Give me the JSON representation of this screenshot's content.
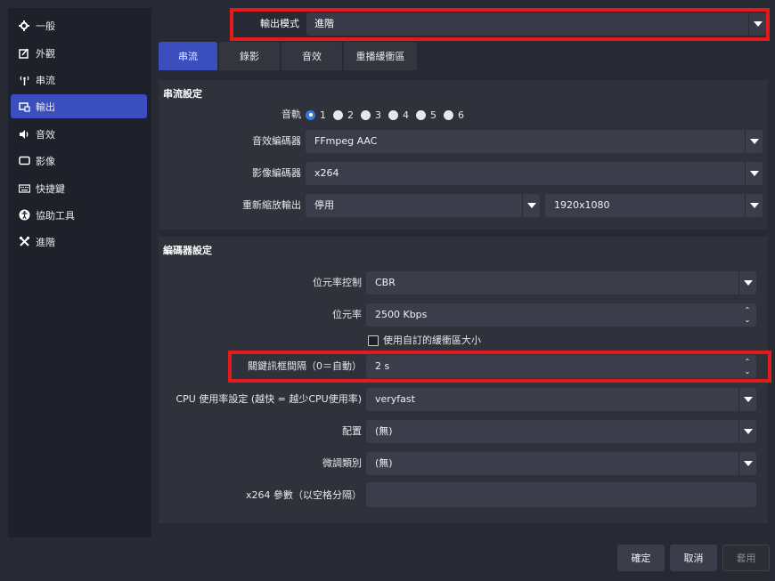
{
  "sidebar": {
    "items": [
      {
        "label": "一般",
        "icon": "gear-icon",
        "active": false
      },
      {
        "label": "外觀",
        "icon": "appearance-icon",
        "active": false
      },
      {
        "label": "串流",
        "icon": "antenna-icon",
        "active": false
      },
      {
        "label": "輸出",
        "icon": "output-icon",
        "active": true
      },
      {
        "label": "音效",
        "icon": "speaker-icon",
        "active": false
      },
      {
        "label": "影像",
        "icon": "monitor-icon",
        "active": false
      },
      {
        "label": "快捷鍵",
        "icon": "keyboard-icon",
        "active": false
      },
      {
        "label": "協助工具",
        "icon": "accessibility-icon",
        "active": false
      },
      {
        "label": "進階",
        "icon": "tools-icon",
        "active": false
      }
    ]
  },
  "output_mode": {
    "label": "輸出模式",
    "value": "進階"
  },
  "tabs": [
    {
      "label": "串流",
      "active": true
    },
    {
      "label": "錄影",
      "active": false
    },
    {
      "label": "音效",
      "active": false
    },
    {
      "label": "重播緩衝區",
      "active": false
    }
  ],
  "stream_settings": {
    "title": "串流設定",
    "audio_track_label": "音軌",
    "audio_tracks": [
      "1",
      "2",
      "3",
      "4",
      "5",
      "6"
    ],
    "audio_track_selected": "1",
    "audio_encoder_label": "音效編碼器",
    "audio_encoder_value": "FFmpeg AAC",
    "video_encoder_label": "影像編碼器",
    "video_encoder_value": "x264",
    "rescale_label": "重新縮放輸出",
    "rescale_value": "停用",
    "rescale_resolution": "1920x1080"
  },
  "encoder_settings": {
    "title": "編碼器設定",
    "rate_control_label": "位元率控制",
    "rate_control_value": "CBR",
    "bitrate_label": "位元率",
    "bitrate_value": "2500 Kbps",
    "custom_buffer_label": "使用自訂的緩衝區大小",
    "custom_buffer_checked": false,
    "keyframe_label": "關鍵訊框間隔（0＝自動）",
    "keyframe_value": "2 s",
    "cpu_preset_label": "CPU 使用率設定 (越快 = 越少CPU使用率)",
    "cpu_preset_value": "veryfast",
    "profile_label": "配置",
    "profile_value": "(無)",
    "tune_label": "微調類別",
    "tune_value": "(無)",
    "x264_opts_label": "x264 參數（以空格分隔）",
    "x264_opts_value": ""
  },
  "buttons": {
    "ok": "確定",
    "cancel": "取消",
    "apply": "套用"
  },
  "colors": {
    "accent": "#3a4fbd",
    "highlight": "#e51b1b",
    "background": "#272a33"
  }
}
